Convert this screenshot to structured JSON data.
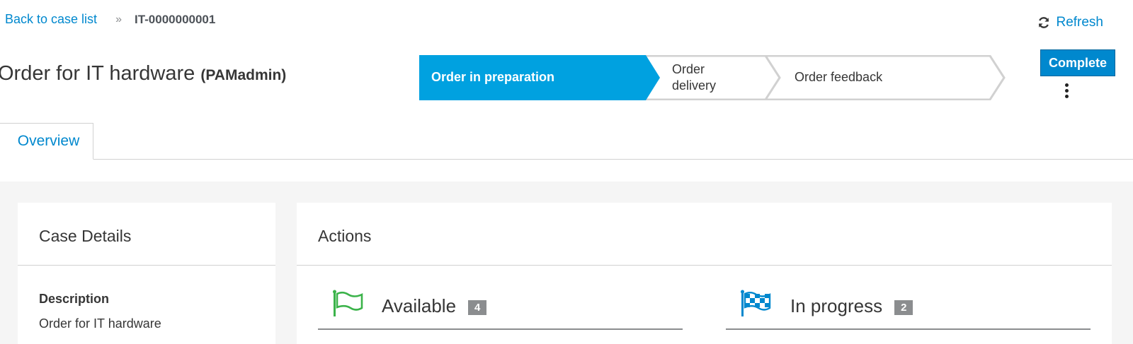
{
  "breadcrumb": {
    "back_label": "Back to case list",
    "separator": "»",
    "current": "IT-0000000001"
  },
  "refresh_label": "Refresh",
  "case": {
    "title": "Order for IT hardware",
    "owner": "(PAMadmin)"
  },
  "stages": [
    {
      "label": "Order in preparation",
      "status": "active"
    },
    {
      "label_line1": "Order",
      "label_line2": "delivery",
      "status": "pending"
    },
    {
      "label": "Order feedback",
      "status": "pending"
    }
  ],
  "complete_label": "Complete",
  "tabs": [
    {
      "label": "Overview",
      "active": true
    }
  ],
  "details": {
    "heading": "Case Details",
    "description_label": "Description",
    "description_value": "Order for IT hardware"
  },
  "actions": {
    "heading": "Actions",
    "available": {
      "label": "Available",
      "count": "4"
    },
    "in_progress": {
      "label": "In progress",
      "count": "2"
    }
  },
  "colors": {
    "accent": "#0088ce",
    "stage_active": "#00a1e0",
    "available_flag": "#3bb34a",
    "in_progress_flag": "#0088ce"
  },
  "icons": {
    "refresh": "refresh-icon",
    "kebab": "kebab-icon",
    "available": "flag-icon",
    "in_progress": "checkered-flag-icon"
  }
}
